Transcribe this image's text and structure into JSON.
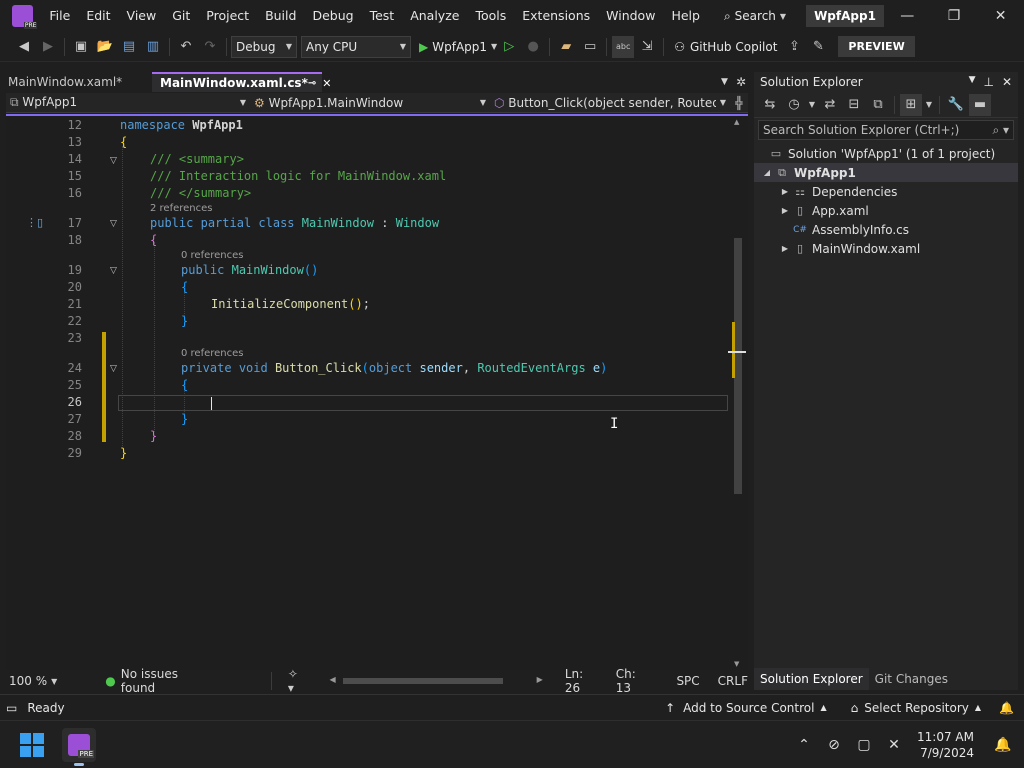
{
  "titlebar": {
    "menu": [
      "File",
      "Edit",
      "View",
      "Git",
      "Project",
      "Build",
      "Debug",
      "Test",
      "Analyze",
      "Tools",
      "Extensions",
      "Window",
      "Help"
    ],
    "search_label": "Search",
    "project_name": "WpfApp1",
    "logo_badge": "PRE"
  },
  "toolbar": {
    "config": "Debug",
    "platform": "Any CPU",
    "run_target": "WpfApp1",
    "copilot_label": "GitHub Copilot",
    "preview_label": "PREVIEW"
  },
  "tabs": [
    {
      "label": "MainWindow.xaml*",
      "active": false
    },
    {
      "label": "MainWindow.xaml.cs*",
      "active": true
    }
  ],
  "navbar": {
    "project": "WpfApp1",
    "class": "WpfApp1.MainWindow",
    "member": "Button_Click(object sender, RoutedEve"
  },
  "editor": {
    "line_numbers": [
      "12",
      "13",
      "14",
      "15",
      "16",
      "17",
      "18",
      "19",
      "20",
      "21",
      "22",
      "23",
      "24",
      "25",
      "26",
      "27",
      "28",
      "29"
    ],
    "codelens_2refs": "2 references",
    "codelens_0refs_a": "0 references",
    "codelens_0refs_b": "0 references",
    "current_line": "26"
  },
  "editor_status": {
    "zoom": "100 %",
    "issues": "No issues found",
    "ln": "Ln: 26",
    "ch": "Ch: 13",
    "spc": "SPC",
    "eol": "CRLF"
  },
  "solution_explorer": {
    "title": "Solution Explorer",
    "search_placeholder": "Search Solution Explorer (Ctrl+;)",
    "solution_label": "Solution 'WpfApp1' (1 of 1 project)",
    "project": "WpfApp1",
    "items": [
      "Dependencies",
      "App.xaml",
      "AssemblyInfo.cs",
      "MainWindow.xaml"
    ],
    "tabs": [
      "Solution Explorer",
      "Git Changes"
    ]
  },
  "statusbar": {
    "ready": "Ready",
    "source_control": "Add to Source Control",
    "repository": "Select Repository"
  },
  "taskbar": {
    "time": "11:07 AM",
    "date": "7/9/2024"
  },
  "colors": {
    "accent": "#7f6cf3",
    "keyword": "#569cd6",
    "type": "#4ec9b0",
    "method": "#dcdcaa",
    "comment": "#57a64a",
    "change_bar": "#c4a000"
  }
}
